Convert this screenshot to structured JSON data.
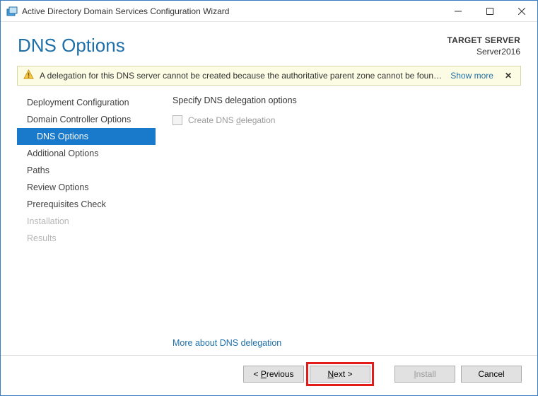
{
  "window": {
    "title": "Active Directory Domain Services Configuration Wizard"
  },
  "header": {
    "title": "DNS Options",
    "target_label": "TARGET SERVER",
    "target_value": "Server2016"
  },
  "warning": {
    "message": "A delegation for this DNS server cannot be created because the authoritative parent zone cannot be found...",
    "show_more": "Show more"
  },
  "sidebar": {
    "items": [
      {
        "label": "Deployment Configuration",
        "state": "normal"
      },
      {
        "label": "Domain Controller Options",
        "state": "normal"
      },
      {
        "label": "DNS Options",
        "state": "active"
      },
      {
        "label": "Additional Options",
        "state": "normal"
      },
      {
        "label": "Paths",
        "state": "normal"
      },
      {
        "label": "Review Options",
        "state": "normal"
      },
      {
        "label": "Prerequisites Check",
        "state": "normal"
      },
      {
        "label": "Installation",
        "state": "disabled"
      },
      {
        "label": "Results",
        "state": "disabled"
      }
    ]
  },
  "main": {
    "heading": "Specify DNS delegation options",
    "checkbox_label_pre": "Create DNS ",
    "checkbox_label_u": "d",
    "checkbox_label_post": "elegation",
    "more_link": "More about DNS delegation"
  },
  "footer": {
    "previous_pre": "< ",
    "previous_u": "P",
    "previous_post": "revious",
    "next_u": "N",
    "next_post": "ext >",
    "install_u": "I",
    "install_post": "nstall",
    "cancel": "Cancel"
  }
}
